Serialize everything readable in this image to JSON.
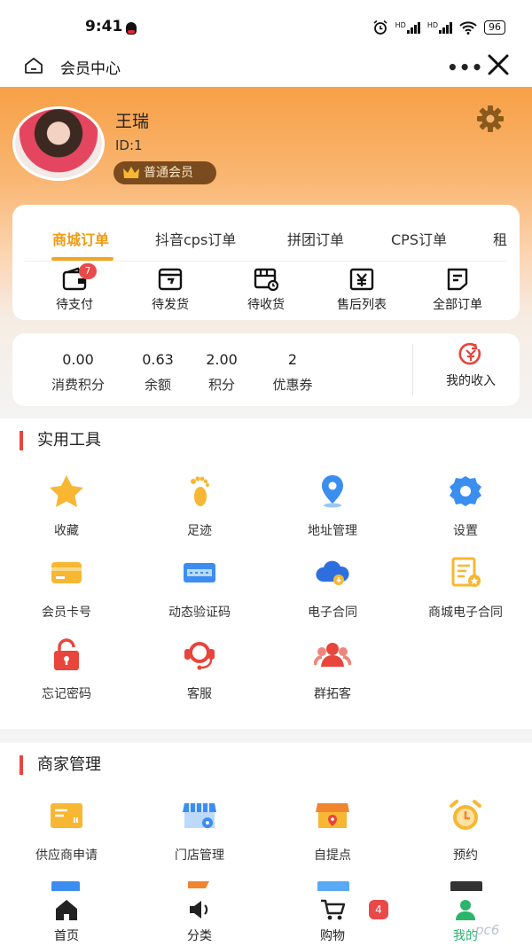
{
  "status_bar": {
    "time": "9:41",
    "battery": "96",
    "hd1": "HD",
    "hd2": "HD"
  },
  "nav": {
    "title": "会员中心",
    "more": "•••"
  },
  "profile": {
    "name": "王瑞",
    "id": "ID:1",
    "level": "普通会员"
  },
  "orders": {
    "tabs": [
      "商城订单",
      "抖音cps订单",
      "拼团订单",
      "CPS订单",
      "租"
    ],
    "active_tab": 0,
    "items": [
      {
        "label": "待支付",
        "icon": "wallet-icon",
        "badge": "7"
      },
      {
        "label": "待发货",
        "icon": "box-send-icon"
      },
      {
        "label": "待收货",
        "icon": "truck-clock-icon"
      },
      {
        "label": "售后列表",
        "icon": "yen-service-icon"
      },
      {
        "label": "全部订单",
        "icon": "order-list-icon"
      }
    ]
  },
  "stats": {
    "items": [
      {
        "value": "0.00",
        "label": "消费积分"
      },
      {
        "value": "0.63",
        "label": "余额"
      },
      {
        "value": "2.00",
        "label": "积分"
      },
      {
        "value": "2",
        "label": "优惠券"
      }
    ],
    "income_label": "我的收入"
  },
  "tools": {
    "title": "实用工具",
    "items": [
      {
        "label": "收藏",
        "icon": "star-icon"
      },
      {
        "label": "足迹",
        "icon": "footprint-icon"
      },
      {
        "label": "地址管理",
        "icon": "location-icon"
      },
      {
        "label": "设置",
        "icon": "settings-gear-icon"
      },
      {
        "label": "会员卡号",
        "icon": "member-card-icon"
      },
      {
        "label": "动态验证码",
        "icon": "verify-code-icon"
      },
      {
        "label": "电子合同",
        "icon": "cloud-contract-icon"
      },
      {
        "label": "商城电子合同",
        "icon": "mall-contract-icon"
      },
      {
        "label": "忘记密码",
        "icon": "lock-icon"
      },
      {
        "label": "客服",
        "icon": "headset-icon"
      },
      {
        "label": "群拓客",
        "icon": "group-icon"
      }
    ]
  },
  "merchant": {
    "title": "商家管理",
    "items": [
      {
        "label": "供应商申请",
        "icon": "supplier-icon"
      },
      {
        "label": "门店管理",
        "icon": "store-settings-icon"
      },
      {
        "label": "自提点",
        "icon": "pickup-store-icon"
      },
      {
        "label": "预约",
        "icon": "alarm-clock-icon"
      }
    ]
  },
  "tabbar": {
    "items": [
      {
        "label": "首页",
        "icon": "home-icon"
      },
      {
        "label": "分类",
        "icon": "category-speaker-icon"
      },
      {
        "label": "购物",
        "icon": "cart-icon"
      },
      {
        "label": "我的",
        "icon": "user-icon"
      }
    ],
    "active": 3,
    "cart_badge": "4"
  },
  "watermark": "pc6",
  "colors": {
    "accent": "#f19b15",
    "brand_orange": "#f7a046",
    "active_green": "#2bb56c",
    "badge_red": "#e84a4a"
  }
}
